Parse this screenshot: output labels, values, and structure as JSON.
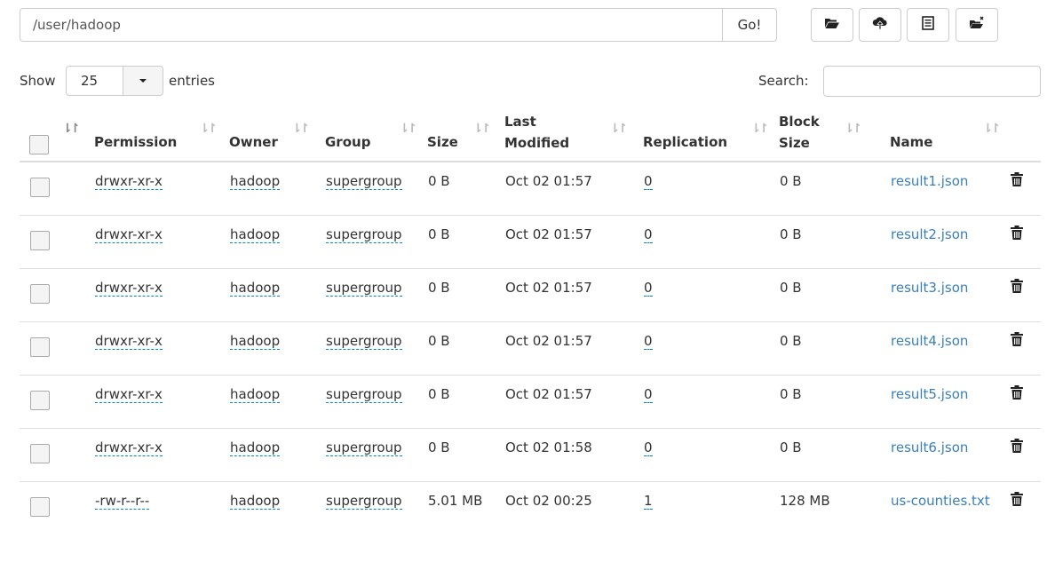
{
  "toolbar": {
    "path_value": "/user/hadoop",
    "go_label": "Go!",
    "icons": [
      "folder-open-icon",
      "cloud-upload-icon",
      "list-alt-icon",
      "scissors-icon"
    ]
  },
  "length": {
    "show_label": "Show",
    "value": "25",
    "entries_label": "entries"
  },
  "search": {
    "label": "Search:",
    "value": ""
  },
  "table": {
    "headers": {
      "permission": "Permission",
      "owner": "Owner",
      "group": "Group",
      "size": "Size",
      "last_modified": "Last Modified",
      "replication": "Replication",
      "block_size": "Block Size",
      "name": "Name"
    },
    "rows": [
      {
        "permission": "drwxr-xr-x",
        "owner": "hadoop",
        "group": "supergroup",
        "size": "0 B",
        "last_modified": "Oct 02 01:57",
        "replication": "0",
        "block_size": "0 B",
        "name": "result1.json"
      },
      {
        "permission": "drwxr-xr-x",
        "owner": "hadoop",
        "group": "supergroup",
        "size": "0 B",
        "last_modified": "Oct 02 01:57",
        "replication": "0",
        "block_size": "0 B",
        "name": "result2.json"
      },
      {
        "permission": "drwxr-xr-x",
        "owner": "hadoop",
        "group": "supergroup",
        "size": "0 B",
        "last_modified": "Oct 02 01:57",
        "replication": "0",
        "block_size": "0 B",
        "name": "result3.json"
      },
      {
        "permission": "drwxr-xr-x",
        "owner": "hadoop",
        "group": "supergroup",
        "size": "0 B",
        "last_modified": "Oct 02 01:57",
        "replication": "0",
        "block_size": "0 B",
        "name": "result4.json"
      },
      {
        "permission": "drwxr-xr-x",
        "owner": "hadoop",
        "group": "supergroup",
        "size": "0 B",
        "last_modified": "Oct 02 01:57",
        "replication": "0",
        "block_size": "0 B",
        "name": "result5.json"
      },
      {
        "permission": "drwxr-xr-x",
        "owner": "hadoop",
        "group": "supergroup",
        "size": "0 B",
        "last_modified": "Oct 02 01:58",
        "replication": "0",
        "block_size": "0 B",
        "name": "result6.json"
      },
      {
        "permission": "-rw-r--r--",
        "owner": "hadoop",
        "group": "supergroup",
        "size": "5.01 MB",
        "last_modified": "Oct 02 00:25",
        "replication": "1",
        "block_size": "128 MB",
        "name": "us-counties.txt"
      }
    ]
  },
  "colors": {
    "link": "#3a7fb8",
    "editable_underline": "#0088cc",
    "border": "#dddddd"
  }
}
